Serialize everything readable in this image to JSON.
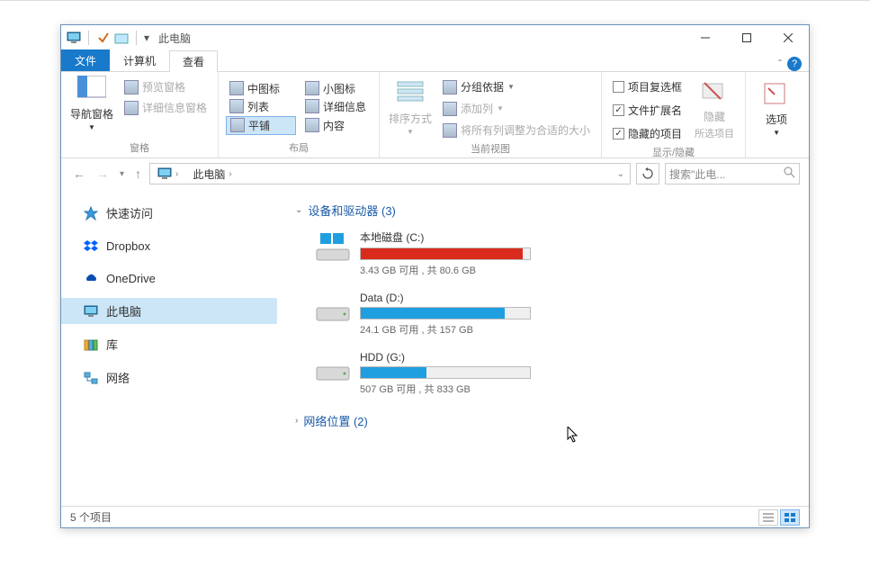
{
  "titlebar": {
    "title": "此电脑"
  },
  "tabs": {
    "file": "文件",
    "computer": "计算机",
    "view": "查看"
  },
  "ribbon": {
    "panes": {
      "nav_pane": "导航窗格",
      "preview_pane": "预览窗格",
      "details_pane": "详细信息窗格",
      "label": "窗格"
    },
    "layout": {
      "medium_icons": "中图标",
      "small_icons": "小图标",
      "list": "列表",
      "details": "详细信息",
      "tiles": "平铺",
      "content": "内容",
      "label": "布局"
    },
    "currentview": {
      "sort": "排序方式",
      "group_by": "分组依据",
      "add_columns": "添加列",
      "size_columns": "将所有列调整为合适的大小",
      "label": "当前视图"
    },
    "showhide": {
      "item_checkboxes": "项目复选框",
      "file_ext": "文件扩展名",
      "hidden": "隐藏的项目",
      "hide_btn": "隐藏",
      "hide_btn_sub": "所选项目",
      "label": "显示/隐藏"
    },
    "options": {
      "options": "选项"
    }
  },
  "nav": {
    "segment": "此电脑"
  },
  "search": {
    "placeholder": "搜索\"此电..."
  },
  "sidebar": {
    "items": [
      {
        "label": "快速访问",
        "icon": "star"
      },
      {
        "label": "Dropbox",
        "icon": "dropbox"
      },
      {
        "label": "OneDrive",
        "icon": "onedrive"
      },
      {
        "label": "此电脑",
        "icon": "pc",
        "selected": true
      },
      {
        "label": "库",
        "icon": "library"
      },
      {
        "label": "网络",
        "icon": "network"
      }
    ]
  },
  "main": {
    "group1": {
      "title": "设备和驱动器 (3)"
    },
    "drives": [
      {
        "name": "本地磁盘 (C:)",
        "status": "3.43 GB 可用 , 共 80.6 GB",
        "fill_pct": 96,
        "color": "#d92a1c",
        "os": true
      },
      {
        "name": "Data (D:)",
        "status": "24.1 GB 可用 , 共 157 GB",
        "fill_pct": 85,
        "color": "#1f9fe0",
        "os": false
      },
      {
        "name": "HDD (G:)",
        "status": "507 GB 可用 , 共 833 GB",
        "fill_pct": 39,
        "color": "#1f9fe0",
        "os": false
      }
    ],
    "group2": {
      "title": "网络位置 (2)"
    }
  },
  "statusbar": {
    "count": "5 个项目"
  }
}
